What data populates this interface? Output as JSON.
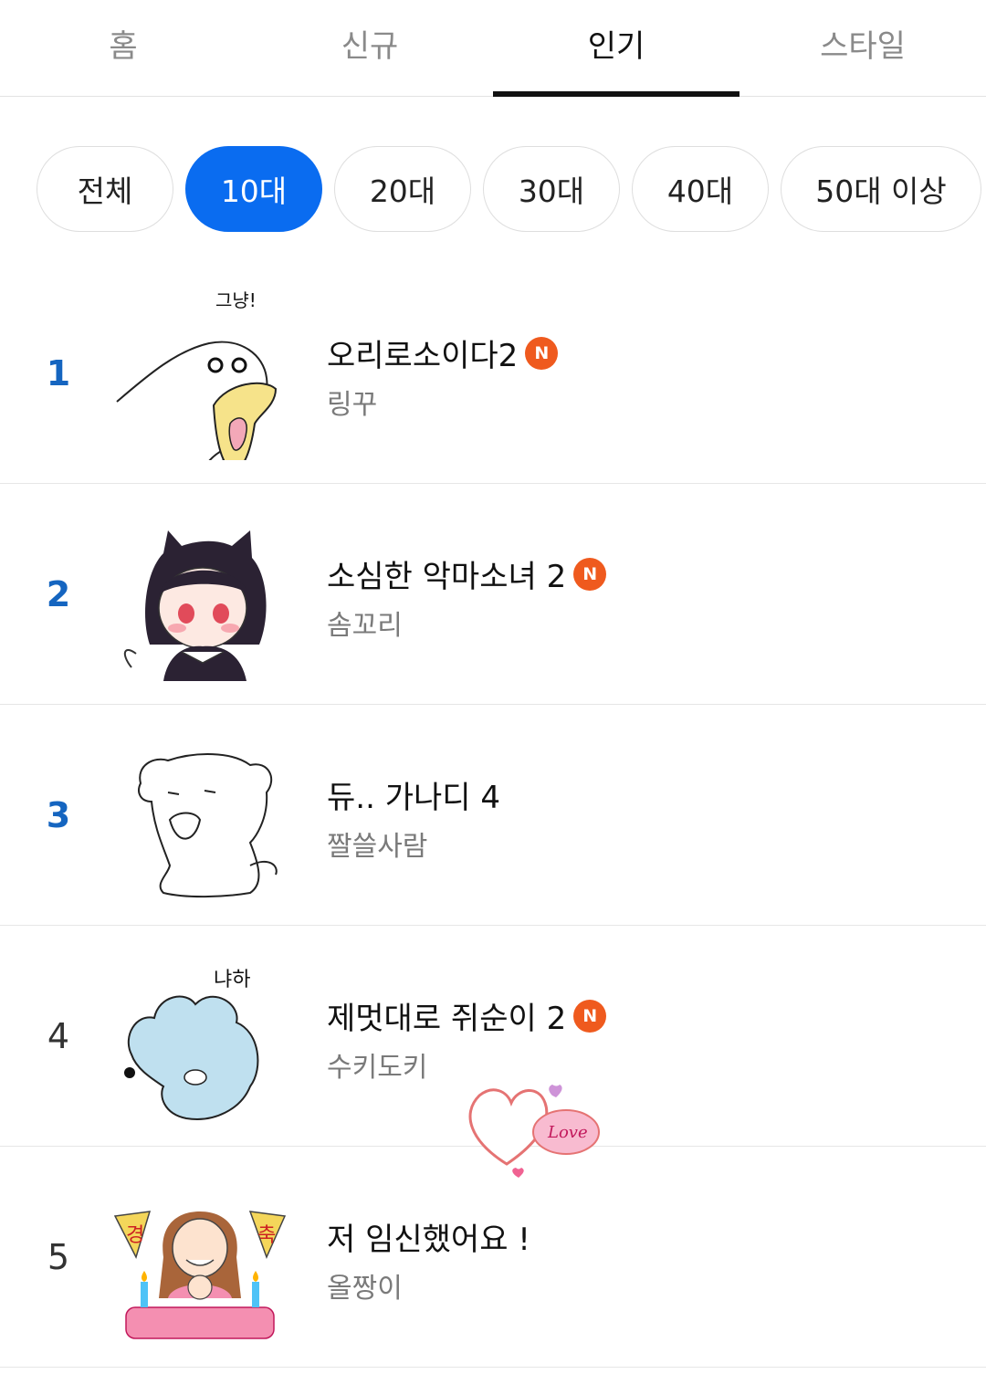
{
  "tabs": [
    {
      "label": "홈"
    },
    {
      "label": "신규"
    },
    {
      "label": "인기",
      "active": true
    },
    {
      "label": "스타일"
    }
  ],
  "filters": [
    {
      "label": "전체"
    },
    {
      "label": "10대",
      "active": true
    },
    {
      "label": "20대"
    },
    {
      "label": "30대"
    },
    {
      "label": "40대"
    },
    {
      "label": "50대 이상"
    }
  ],
  "badge_label": "N",
  "colors": {
    "accent": "#0a6cf0",
    "rank_top": "#1565c0",
    "new_badge": "#ef5a1e"
  },
  "items": [
    {
      "rank": "1",
      "title": "오리로소이다2",
      "author": "링꾸",
      "is_new": true,
      "thumb": "duck-sticker",
      "thumb_text": "그냥!"
    },
    {
      "rank": "2",
      "title": "소심한 악마소녀 2",
      "author": "솜꼬리",
      "is_new": true,
      "thumb": "devil-girl-sticker"
    },
    {
      "rank": "3",
      "title": "듀.. 가나디 4",
      "author": "짤쓸사람",
      "is_new": false,
      "thumb": "white-dog-sticker"
    },
    {
      "rank": "4",
      "title": "제멋대로 쥐순이 2",
      "author": "수키도키",
      "is_new": true,
      "thumb": "blue-mouse-sticker",
      "thumb_text": "냐하"
    },
    {
      "rank": "5",
      "title": "저 임신했어요 !",
      "author": "올짱이",
      "is_new": false,
      "thumb": "congrats-sticker",
      "thumb_text_left": "경",
      "thumb_text_right": "축"
    }
  ],
  "overlay_sticker_text": "Love"
}
